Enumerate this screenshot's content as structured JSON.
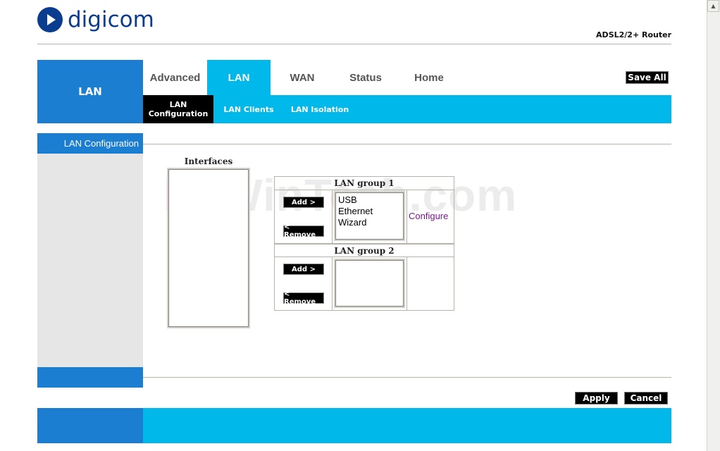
{
  "brand": {
    "name": "digicom",
    "model": "ADSL2/2+ Router"
  },
  "section_title": "LAN",
  "tabs": [
    {
      "label": "Advanced"
    },
    {
      "label": "LAN"
    },
    {
      "label": "WAN"
    },
    {
      "label": "Status"
    },
    {
      "label": "Home"
    }
  ],
  "save_all": "Save All",
  "subtabs": [
    {
      "label": "LAN\nConfiguration"
    },
    {
      "label": "LAN Clients"
    },
    {
      "label": "LAN Isolation"
    }
  ],
  "sidebar": {
    "heading": "LAN Configuration"
  },
  "interfaces": {
    "title": "Interfaces",
    "items": []
  },
  "groups": [
    {
      "title": "LAN group 1",
      "add": "Add >",
      "remove": "< Remove",
      "items": [
        "USB",
        "Ethernet",
        "Wizard"
      ],
      "configure": "Configure"
    },
    {
      "title": "LAN group 2",
      "add": "Add >",
      "remove": "< Remove",
      "items": []
    }
  ],
  "actions": {
    "apply": "Apply",
    "cancel": "Cancel"
  },
  "watermark": "PcWinTech.com",
  "colors": {
    "primary_blue": "#1b7ed1",
    "cyan": "#00b9ea",
    "brand_navy": "#0a3d8f"
  }
}
